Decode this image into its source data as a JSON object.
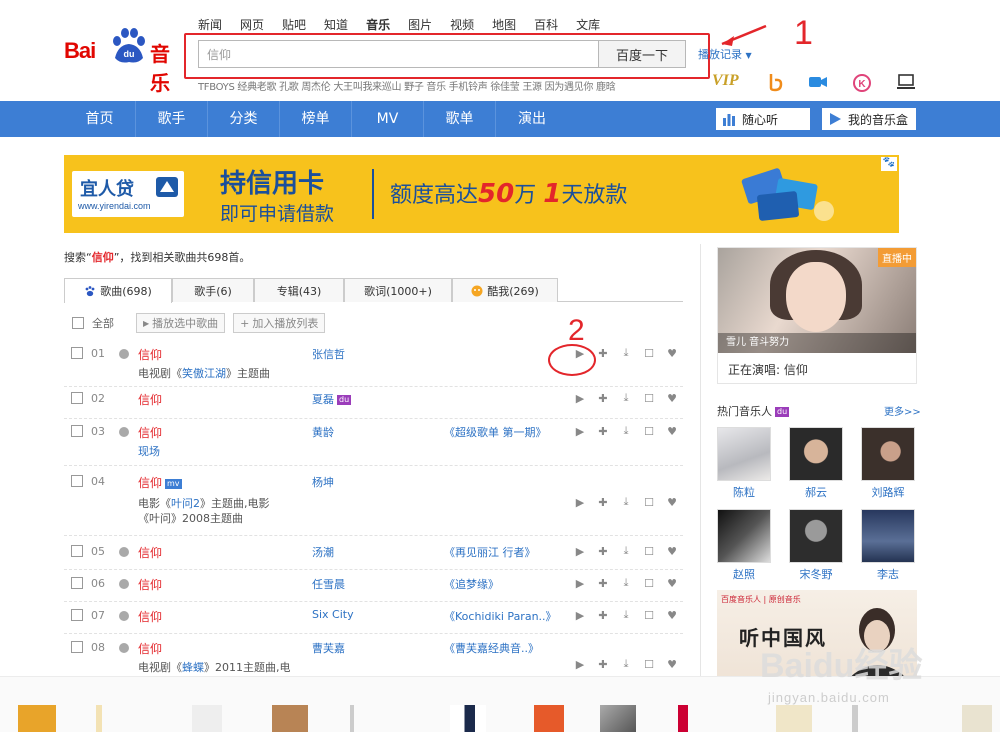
{
  "topnav": [
    "新闻",
    "网页",
    "贴吧",
    "知道",
    "音乐",
    "图片",
    "视频",
    "地图",
    "百科",
    "文库"
  ],
  "topnav_active": "音乐",
  "logo": {
    "bai": "Bai",
    "du": "du",
    "yinyue": "音乐"
  },
  "search": {
    "value": "信仰",
    "button": "百度一下"
  },
  "history_label": "播放记录",
  "hot_words": "TFBOYS  经典老歌  孔歌  周杰伦  大王叫我来巡山  野子  音乐  手机铃声  徐佳莹  王源 因为遇见你  鹿晗",
  "header_icons": {
    "vip": "VIP"
  },
  "mainnav": [
    "首页",
    "歌手",
    "分类",
    "榜单",
    "MV",
    "歌单",
    "演出"
  ],
  "nav_buttons": {
    "suixin": "随心听",
    "musicbox": "我的音乐盒"
  },
  "ad": {
    "brand": "宜人贷",
    "brand_url": "www.yirendai.com",
    "headline": "持信用卡",
    "subline": "即可申请借款",
    "offer_pre": "额度高达",
    "offer_amount": "50",
    "offer_unit": "万",
    "offer_days": "1",
    "offer_post": "天放款"
  },
  "summary": {
    "pre": "搜索“",
    "keyword": "信仰",
    "post": "”，找到相关歌曲共698首。"
  },
  "tabs": [
    {
      "label": "歌曲(698)",
      "active": true
    },
    {
      "label": "歌手(6)",
      "active": false
    },
    {
      "label": "专辑(43)",
      "active": false
    },
    {
      "label": "歌词(1000+)",
      "active": false
    },
    {
      "label": "酷我(269)",
      "active": false
    }
  ],
  "toolbar": {
    "select_all": "全部",
    "play_selected": "播放选中歌曲",
    "add_to_list": "加入播放列表"
  },
  "songs": [
    {
      "num": "01",
      "title": "信仰",
      "sub_pre": "电视剧《",
      "sub_link": "笑傲江湖",
      "sub_post": "》主题曲",
      "artist": "张信哲",
      "album": ""
    },
    {
      "num": "02",
      "title": "信仰",
      "sub_pre": "",
      "sub_link": "",
      "sub_post": "",
      "artist": "夏磊",
      "album": ""
    },
    {
      "num": "03",
      "title": "信仰",
      "sub_pre": "",
      "sub_link": "现场",
      "sub_post": "",
      "artist": "黄龄",
      "album": "《超级歌单 第一期》"
    },
    {
      "num": "04",
      "title": "信仰",
      "sub_pre": "电影《",
      "sub_link": "叶问2",
      "sub_post": "》主题曲,电影《叶问》2008主题曲",
      "artist": "杨坤",
      "album": ""
    },
    {
      "num": "05",
      "title": "信仰",
      "sub_pre": "",
      "sub_link": "",
      "sub_post": "",
      "artist": "汤潮",
      "album": "《再见丽江 行者》"
    },
    {
      "num": "06",
      "title": "信仰",
      "sub_pre": "",
      "sub_link": "",
      "sub_post": "",
      "artist": "任雪晨",
      "album": "《追梦缘》"
    },
    {
      "num": "07",
      "title": "信仰",
      "sub_pre": "",
      "sub_link": "",
      "sub_post": "",
      "artist": "Six City",
      "album": "《Kochidiki Paran..》"
    },
    {
      "num": "08",
      "title": "信仰",
      "sub_pre": "电视剧《",
      "sub_link": "蜂蝶",
      "sub_post": "》2011主题曲,电",
      "artist": "曹芙嘉",
      "album": "《曹芙嘉经典音..》"
    }
  ],
  "live": {
    "tag": "直播中",
    "caption": "雪儿 音斗努力",
    "now_playing": "正在演唱: 信仰"
  },
  "hot_artists": {
    "title": "热门音乐人",
    "more": "更多>>",
    "names": [
      "陈粒",
      "郝云",
      "刘路辉",
      "赵照",
      "宋冬野",
      "李志"
    ]
  },
  "promo": {
    "top": "百度音乐人 | 原创音乐",
    "headline": "听中国风"
  },
  "annotations": {
    "one": "1",
    "two": "2"
  },
  "watermark": {
    "main": "Baidu经验",
    "url": "jingyan.baidu.com"
  },
  "colors": {
    "brand_red": "#e10601",
    "nav_blue": "#3d7ed4",
    "link_blue": "#2d72c4",
    "annotation_red": "#e3262b"
  }
}
